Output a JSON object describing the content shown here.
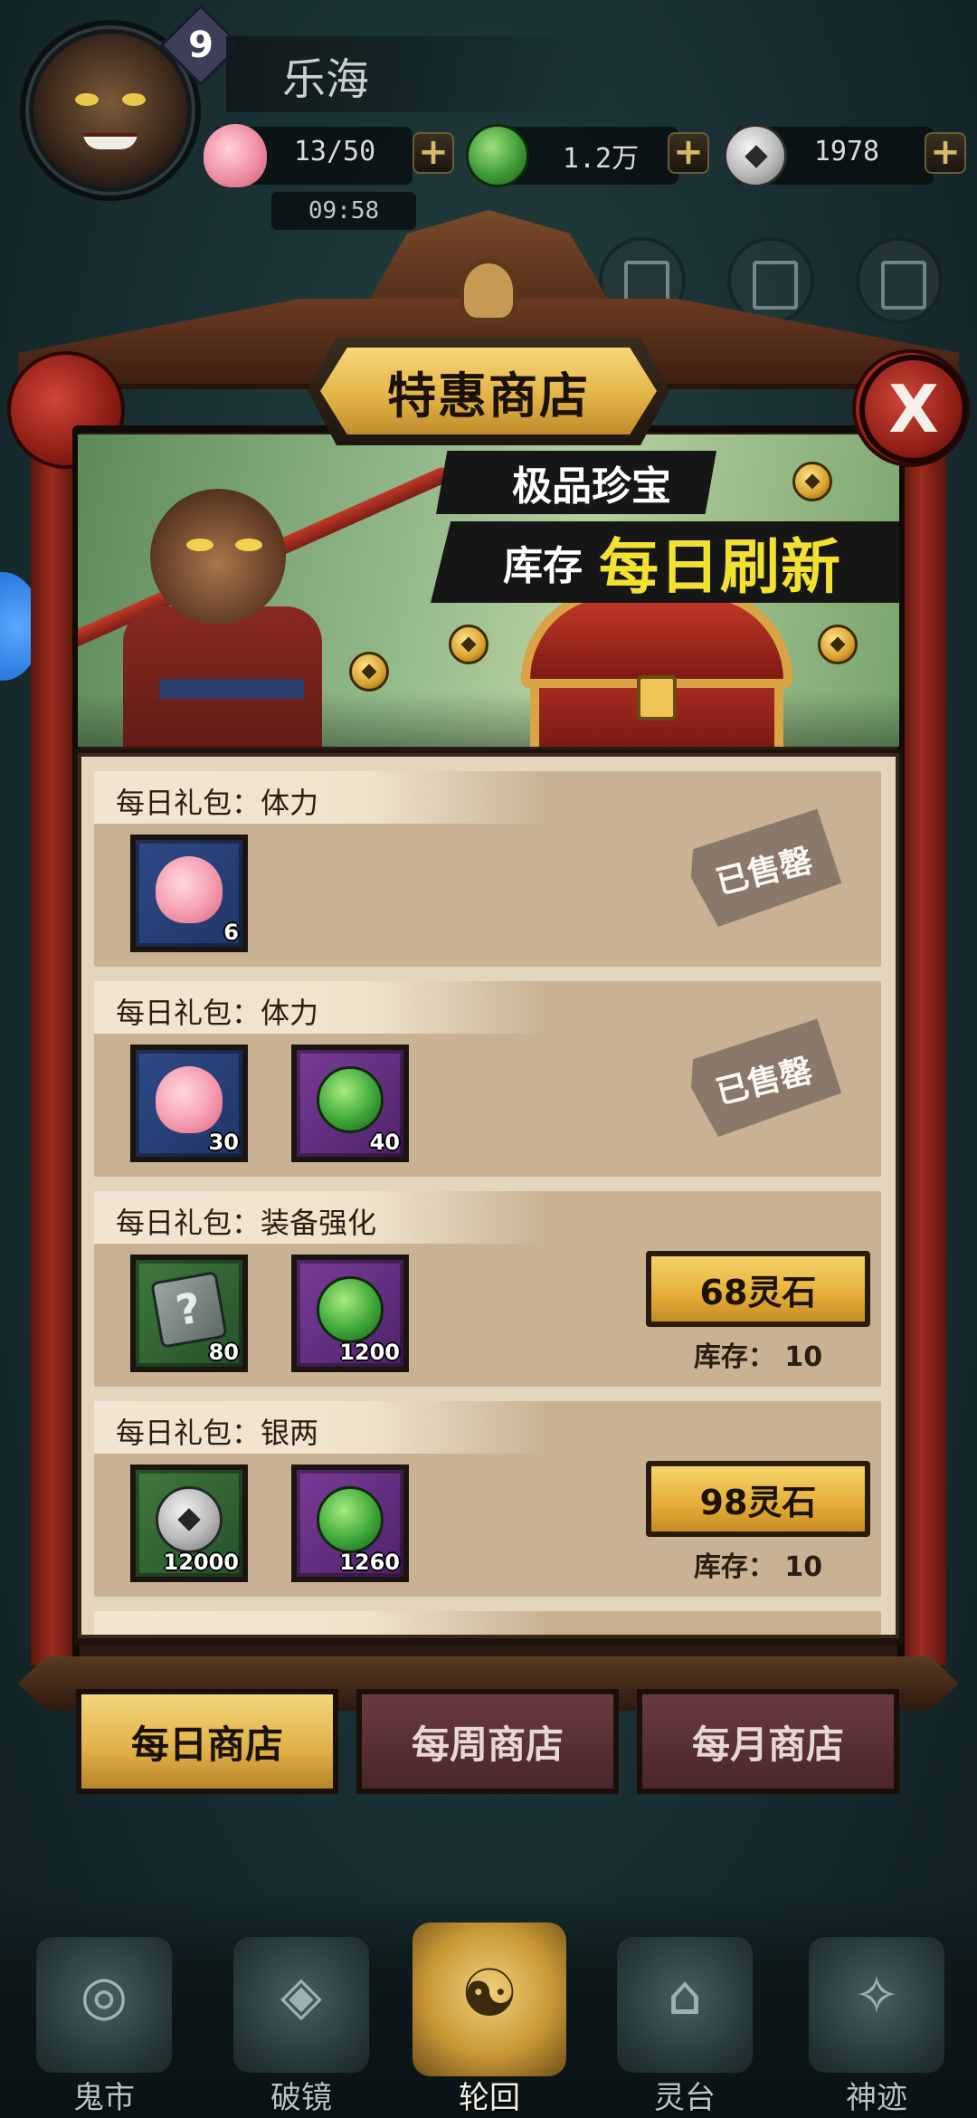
{
  "player": {
    "level": "9",
    "name": "乐海"
  },
  "resources": {
    "stamina": "13/50",
    "jade": "1.2万",
    "silver": "1978",
    "timer": "09:58"
  },
  "shop": {
    "title": "特惠商店",
    "close_label": "X",
    "banner_line1": "极品珍宝",
    "banner_line2_prefix": "库存",
    "banner_line2_highlight": "每日刷新"
  },
  "items": [
    {
      "title": "每日礼包：体力",
      "rewards": [
        {
          "icon": "peach-icon",
          "count": "6",
          "frame": "blue"
        }
      ],
      "status": "已售罄"
    },
    {
      "title": "每日礼包：体力",
      "rewards": [
        {
          "icon": "peach-icon",
          "count": "30",
          "frame": "blue"
        },
        {
          "icon": "jade-icon",
          "count": "40",
          "frame": "purple"
        }
      ],
      "status": "已售罄"
    },
    {
      "title": "每日礼包：装备强化",
      "rewards": [
        {
          "icon": "mystery-book-icon",
          "count": "80",
          "frame": "green"
        },
        {
          "icon": "jade-icon",
          "count": "1200",
          "frame": "purple"
        }
      ],
      "price": "68灵石",
      "stock": "库存： 10"
    },
    {
      "title": "每日礼包：银两",
      "rewards": [
        {
          "icon": "silver-coin-icon",
          "count": "12000",
          "frame": "green"
        },
        {
          "icon": "jade-icon",
          "count": "1260",
          "frame": "purple"
        }
      ],
      "price": "98灵石",
      "stock": "库存： 10"
    }
  ],
  "tabs": [
    {
      "label": "每日商店",
      "active": true
    },
    {
      "label": "每周商店",
      "active": false
    },
    {
      "label": "每月商店",
      "active": false
    }
  ],
  "nav": [
    {
      "label": "鬼市",
      "icon": "market-icon",
      "active": false
    },
    {
      "label": "破镜",
      "icon": "mirror-icon",
      "active": false
    },
    {
      "label": "轮回",
      "icon": "yin-yang-icon",
      "active": true
    },
    {
      "label": "灵台",
      "icon": "temple-icon",
      "active": false
    },
    {
      "label": "神迹",
      "icon": "miracle-icon",
      "active": false
    }
  ],
  "colors": {
    "accent_gold": "#e3b548",
    "frame_red": "#9b2b1e",
    "card_bg": "#c8b293",
    "background": "#1b3335"
  }
}
